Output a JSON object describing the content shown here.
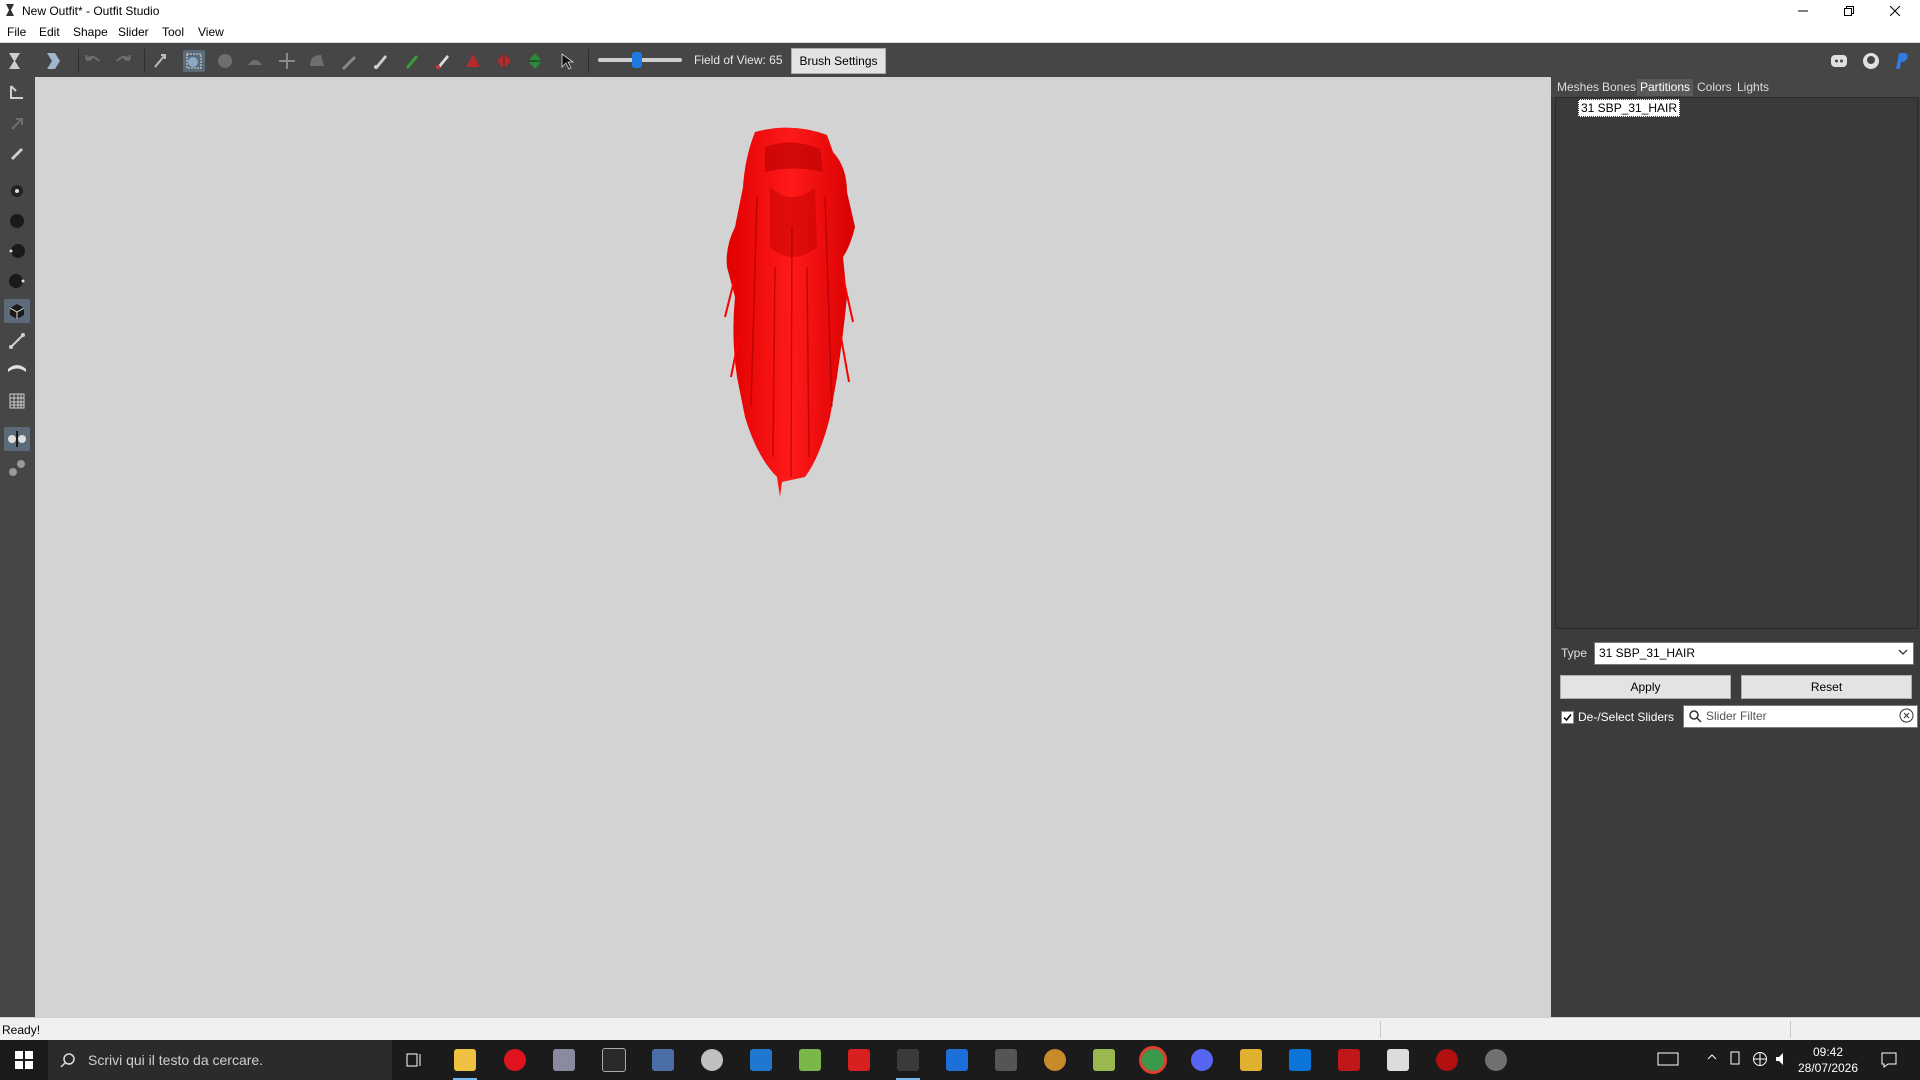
{
  "window": {
    "title": "New Outfit* - Outfit Studio",
    "app_icon": "outfit-studio-icon"
  },
  "menu": [
    "File",
    "Edit",
    "Shape",
    "Slider",
    "Tool",
    "View"
  ],
  "toolbar": {
    "fov_label": "Field of View: 65",
    "fov_value": 65,
    "brush_settings_label": "Brush Settings",
    "tools": [
      "select-icon",
      "select-alt-icon",
      "undo-icon",
      "redo-icon",
      "anchor-icon",
      "mask-icon",
      "inflate-icon",
      "deflate-icon",
      "move-icon",
      "smooth-icon",
      "weight-paint-icon",
      "color-paint-icon",
      "alpha-paint-icon",
      "partition-paint-icon",
      "collapse-vertex-icon",
      "flip-edge-icon",
      "split-edge-icon",
      "cursor-icon"
    ],
    "right_icons": [
      "discord-icon",
      "github-icon",
      "paypal-icon"
    ]
  },
  "left_tools": [
    "transform-icon",
    "pivot-icon",
    "pen-icon",
    "vertex-icon",
    "sphere-icon",
    "sphere-left-icon",
    "sphere-right-icon",
    "cube-icon",
    "bone-icon",
    "fold-icon",
    "grid-icon",
    "symmetry-icon",
    "nodes-icon"
  ],
  "right_panel": {
    "tabs": [
      "Meshes",
      "Bones",
      "Partitions",
      "Colors",
      "Lights"
    ],
    "active_tab": "Partitions",
    "partition_item": "31 SBP_31_HAIR",
    "type_label": "Type",
    "type_value": "31 SBP_31_HAIR",
    "apply_label": "Apply",
    "reset_label": "Reset",
    "deselect_label": "De-/Select Sliders",
    "deselect_checked": true,
    "slider_filter_placeholder": "Slider Filter"
  },
  "status": {
    "text": "Ready!"
  },
  "taskbar": {
    "search_placeholder": "Scrivi qui il testo da cercare.",
    "apps": [
      "task-view-icon",
      "file-explorer-icon",
      "opera-icon",
      "media-app-icon",
      "msi-app-icon",
      "feather-app-icon",
      "blender-icon",
      "blue-app-icon",
      "notepad-icon",
      "f-app-icon",
      "outfit-studio-taskbar-icon",
      "store-icon",
      "terminal-icon",
      "gimp-icon",
      "edit-app-icon",
      "chrome-icon",
      "discord-taskbar-icon",
      "folder-icon",
      "blue-square-icon",
      "red-app-icon",
      "network-app-icon",
      "red-circle-icon",
      "gear-app-icon"
    ],
    "time": "09:42",
    "date": "28/07/2026"
  },
  "colors": {
    "toolbar_bg": "#464646",
    "viewport_bg": "#d3d3d3",
    "mesh_color": "#ff0000",
    "accent": "#1f7ae0"
  }
}
